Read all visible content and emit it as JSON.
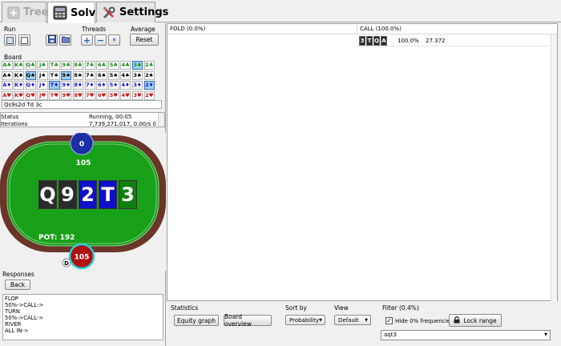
{
  "tabs": [
    {
      "label": "Tree",
      "icon": "tree-icon",
      "state": "disabled"
    },
    {
      "label": "Solve",
      "icon": "calculator-icon",
      "state": "active"
    },
    {
      "label": "Settings",
      "icon": "tools-icon",
      "state": "normal"
    }
  ],
  "run": {
    "label": "Run"
  },
  "threads": {
    "label": "Threads",
    "plus": "+",
    "minus": "−",
    "pause": "⏸"
  },
  "average": {
    "label": "Average",
    "reset_label": "Reset"
  },
  "board": {
    "label": "Board",
    "rows": [
      {
        "suit": "c",
        "cards": [
          "A♣",
          "K♣",
          "Q♣",
          "J♣",
          "T♣",
          "9♣",
          "8♣",
          "7♣",
          "6♣",
          "5♣",
          "4♣",
          "3♣",
          "2♣"
        ]
      },
      {
        "suit": "s",
        "cards": [
          "A♠",
          "K♠",
          "Q♠",
          "J♠",
          "T♠",
          "9♠",
          "8♠",
          "7♠",
          "6♠",
          "5♠",
          "4♠",
          "3♠",
          "2♠"
        ]
      },
      {
        "suit": "d",
        "cards": [
          "A♦",
          "K♦",
          "Q♦",
          "J♦",
          "T♦",
          "9♦",
          "8♦",
          "7♦",
          "6♦",
          "5♦",
          "4♦",
          "3♦",
          "2♦"
        ]
      },
      {
        "suit": "h",
        "cards": [
          "A♥",
          "K♥",
          "Q♥",
          "J♥",
          "T♥",
          "9♥",
          "8♥",
          "7♥",
          "6♥",
          "5♥",
          "4♥",
          "3♥",
          "2♥"
        ]
      }
    ],
    "input_value": "Qs9s2d Td 3c"
  },
  "status": {
    "rows": [
      {
        "key": "Status",
        "value": "Running, 00:05"
      },
      {
        "key": "Iterations",
        "value": "7,739,271,017, 0.00/s 0 thre..."
      }
    ]
  },
  "table": {
    "top_player": {
      "label": "0",
      "stack": "105"
    },
    "bottom_player": {
      "label": "105"
    },
    "dealer": "D",
    "pot": "POT: 192",
    "board_cards": [
      {
        "rank": "Q",
        "color": "#2b2b2b"
      },
      {
        "rank": "9",
        "color": "#2b2b2b"
      },
      {
        "rank": "2",
        "color": "#1010c8"
      },
      {
        "rank": "T",
        "color": "#1010c8"
      },
      {
        "rank": "3",
        "color": "#0f7f0f"
      }
    ]
  },
  "responses": {
    "label": "Responses",
    "back_label": "Back",
    "log": "FLOP\n50%->CALL->\nTURN\n50%->CALL->\nRIVER\nALL IN->"
  },
  "grid": {
    "columns": [
      "FOLD (0.0%)",
      "CALL (100.0%)"
    ],
    "rows": [
      {
        "cards": [
          "3",
          "T",
          "Q",
          "A"
        ],
        "percent": "100.0%",
        "value": "27.372"
      }
    ]
  },
  "controls": {
    "statistics": {
      "label": "Statistics",
      "equity_graph": "Equity graph",
      "board_overview": "Board overview"
    },
    "sort_by": {
      "label": "Sort by",
      "value": "Probability"
    },
    "view": {
      "label": "View",
      "value": "Default"
    },
    "filter": {
      "label": "Filter (0.4%)",
      "hide_label": "Hide 0% frequencies",
      "hide_checked": true,
      "lock_label": "Lock range",
      "input_value": "aqt3"
    }
  }
}
